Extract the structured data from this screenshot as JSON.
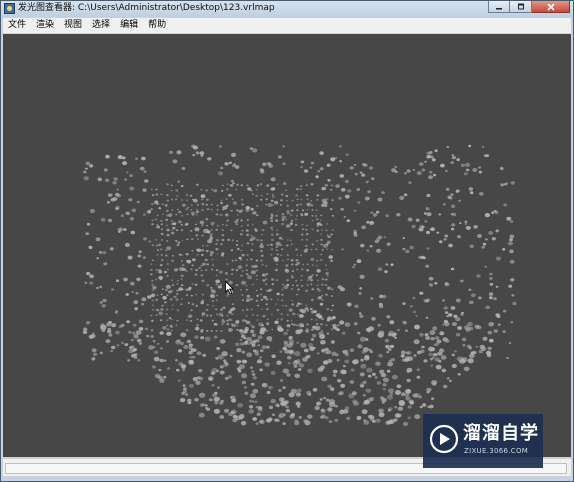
{
  "window": {
    "title": "发光图查看器: C:\\Users\\Administrator\\Desktop\\123.vrlmap"
  },
  "menu": {
    "items": [
      "文件",
      "渲染",
      "视图",
      "选择",
      "编辑",
      "帮助"
    ]
  },
  "icons": {
    "app": "app-icon",
    "minimize": "minimize-icon",
    "maximize": "maximize-icon",
    "close": "close-icon",
    "cursor": "cursor-arrow-icon",
    "watermark_logo": "play-logo-icon"
  },
  "colors": {
    "viewport_background": "#474747",
    "point_color": "#b4b4b4",
    "watermark_background": "#1c3050"
  },
  "watermark": {
    "brand": "溜溜自学",
    "url": "ZIXUE.3066.COM"
  }
}
